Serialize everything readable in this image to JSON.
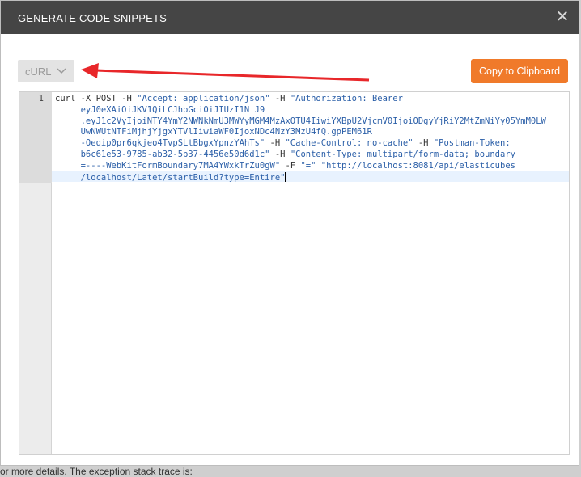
{
  "background": {
    "partial_text": "or more details. The exception stack trace is:"
  },
  "dialog": {
    "title": "GENERATE CODE SNIPPETS",
    "close_icon": "close-icon"
  },
  "language_select": {
    "value": "cURL",
    "icon": "chevron-down-icon"
  },
  "copy_button": {
    "label": "Copy to Clipboard"
  },
  "annotation_arrow": {
    "color": "#e8272a"
  },
  "editor": {
    "line_number": "1",
    "lines": [
      [
        {
          "t": "curl -X POST -H "
        },
        {
          "s": "\"Accept: application/json\""
        },
        {
          "t": " -H "
        },
        {
          "s": "\"Authorization: Bearer"
        }
      ],
      [
        {
          "s": "     eyJ0eXAiOiJKV1QiLCJhbGciOiJIUzI1NiJ9"
        }
      ],
      [
        {
          "s": "     .eyJ1c2VyIjoiNTY4YmY2NWNkNmU3MWYyMGM4MzAxOTU4IiwiYXBpU2VjcmV0IjoiODgyYjRiY2MtZmNiYy05YmM0LW"
        }
      ],
      [
        {
          "s": "     UwNWUtNTFiMjhjYjgxYTVlIiwiaWF0IjoxNDc4NzY3MzU4fQ.gpPEM61R"
        }
      ],
      [
        {
          "s": "     -Oeqip0pr6qkjeo4TvpSLtBbgxYpnzYAhTs\""
        },
        {
          "t": " -H "
        },
        {
          "s": "\"Cache-Control: no-cache\""
        },
        {
          "t": " -H "
        },
        {
          "s": "\"Postman-Token:"
        }
      ],
      [
        {
          "s": "     b6c61e53-9785-ab32-5b37-4456e50d6d1c\""
        },
        {
          "t": " -H "
        },
        {
          "s": "\"Content-Type: multipart/form-data; boundary"
        }
      ],
      [
        {
          "s": "     =----WebKitFormBoundary7MA4YWxkTrZu0gW\""
        },
        {
          "t": " -F "
        },
        {
          "s": "\"=\""
        },
        {
          "t": " "
        },
        {
          "s": "\"http://localhost:8081/api/elasticubes"
        }
      ],
      [
        {
          "s": "     /localhost/Latet/startBuild?type=Entire\""
        }
      ]
    ]
  }
}
